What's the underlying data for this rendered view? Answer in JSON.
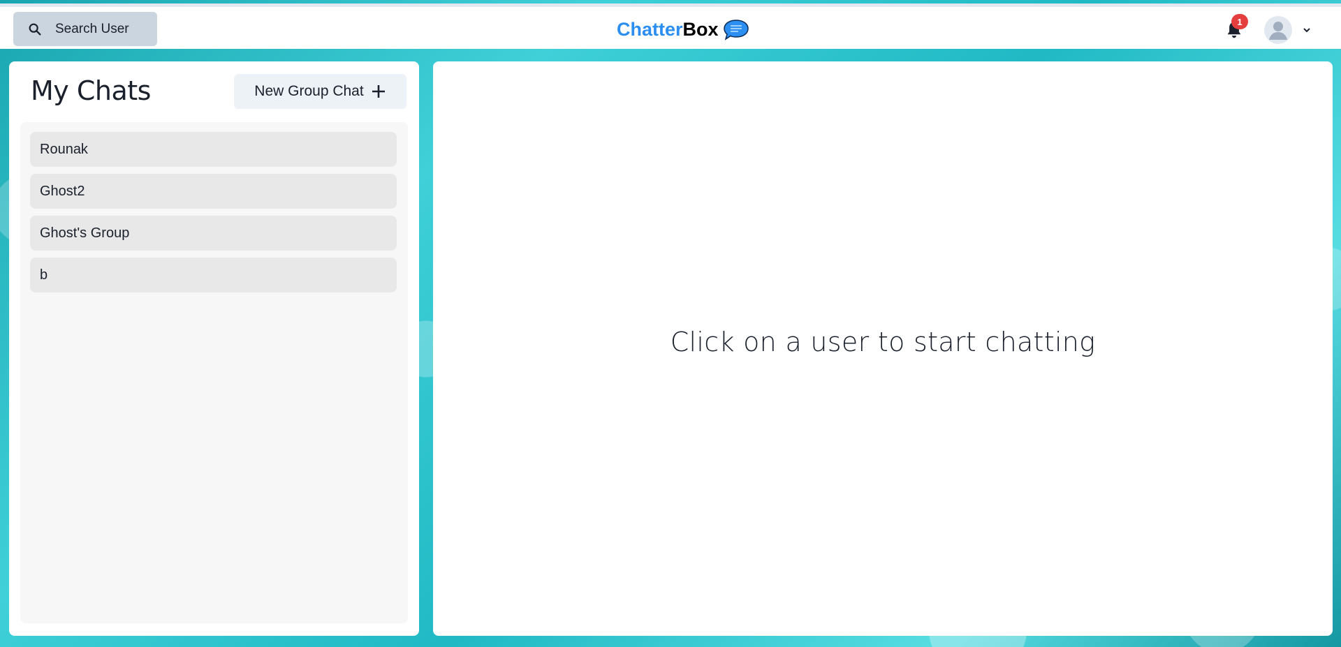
{
  "header": {
    "search_label": "Search User",
    "brand_part1": "Chatter",
    "brand_part2": "Box",
    "brand_icon": "chat-bubble-icon",
    "notification_count": "1",
    "bell_icon": "bell-icon",
    "avatar_icon": "user-avatar-icon",
    "menu_icon": "chevron-down-icon"
  },
  "sidebar": {
    "title": "My Chats",
    "new_group_label": "New Group Chat",
    "chats": [
      {
        "name": "Rounak"
      },
      {
        "name": "Ghost2"
      },
      {
        "name": "Ghost's Group"
      },
      {
        "name": "b"
      }
    ]
  },
  "main": {
    "empty_message": "Click on a user to start chatting"
  },
  "colors": {
    "brand_blue": "#2b8ef0",
    "badge_red": "#e53e3e",
    "background_teal": "#20b9c4"
  }
}
